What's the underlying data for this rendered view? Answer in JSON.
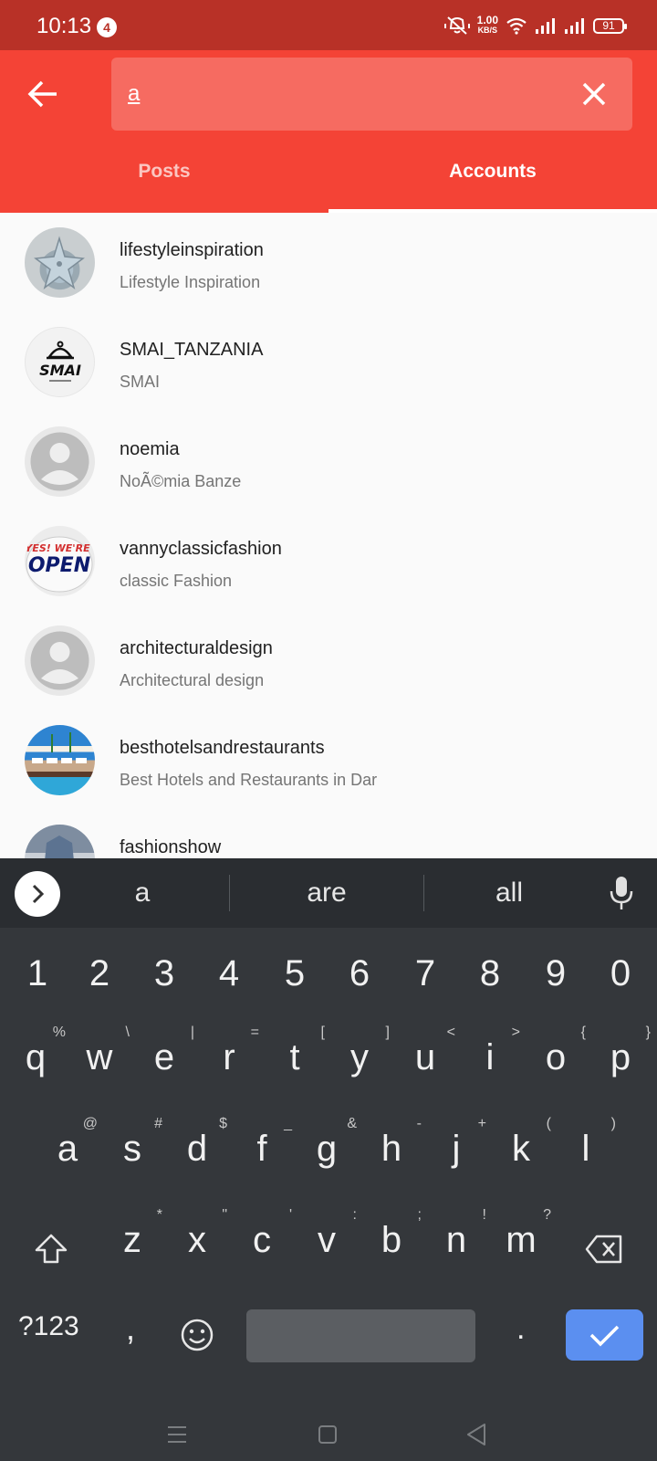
{
  "status_bar": {
    "time": "10:13",
    "notification_count": "4",
    "net_speed_value": "1.00",
    "net_speed_unit": "KB/S",
    "battery": "91"
  },
  "search": {
    "query": "a",
    "placeholder": ""
  },
  "tabs": [
    {
      "label": "Posts",
      "active": false
    },
    {
      "label": "Accounts",
      "active": true
    }
  ],
  "accounts": [
    {
      "username": "lifestyleinspiration",
      "full_name": "Lifestyle Inspiration",
      "avatar": "starfish-photo"
    },
    {
      "username": "SMAI_TANZANIA",
      "full_name": "SMAI",
      "avatar": "smai-logo"
    },
    {
      "username": "noemia",
      "full_name": "NoÃ©mia Banze",
      "avatar": "default-avatar"
    },
    {
      "username": "vannyclassicfashion",
      "full_name": "classic Fashion",
      "avatar": "open-sign"
    },
    {
      "username": "architecturaldesign",
      "full_name": "Architectural design",
      "avatar": "default-avatar"
    },
    {
      "username": "besthotelsandrestaurants",
      "full_name": "Best Hotels and Restaurants in Dar",
      "avatar": "hotel-photo"
    },
    {
      "username": "fashionshow",
      "full_name": "",
      "avatar": "fashion-photo"
    }
  ],
  "avatar_text": {
    "smai": "SMAI",
    "open_line1": "YES! WE'RE",
    "open_line2": "OPEN"
  },
  "keyboard": {
    "suggestions": [
      "a",
      "are",
      "all"
    ],
    "numbers": [
      "1",
      "2",
      "3",
      "4",
      "5",
      "6",
      "7",
      "8",
      "9",
      "0"
    ],
    "row1": [
      {
        "key": "q",
        "sub": "%"
      },
      {
        "key": "w",
        "sub": "\\"
      },
      {
        "key": "e",
        "sub": "|"
      },
      {
        "key": "r",
        "sub": "="
      },
      {
        "key": "t",
        "sub": "["
      },
      {
        "key": "y",
        "sub": "]"
      },
      {
        "key": "u",
        "sub": "<"
      },
      {
        "key": "i",
        "sub": ">"
      },
      {
        "key": "o",
        "sub": "{"
      },
      {
        "key": "p",
        "sub": "}"
      }
    ],
    "row2": [
      {
        "key": "a",
        "sub": "@"
      },
      {
        "key": "s",
        "sub": "#"
      },
      {
        "key": "d",
        "sub": "$"
      },
      {
        "key": "f",
        "sub": "_"
      },
      {
        "key": "g",
        "sub": "&"
      },
      {
        "key": "h",
        "sub": "-"
      },
      {
        "key": "j",
        "sub": "+"
      },
      {
        "key": "k",
        "sub": "("
      },
      {
        "key": "l",
        "sub": ")"
      }
    ],
    "row3": [
      {
        "key": "z",
        "sub": "*"
      },
      {
        "key": "x",
        "sub": "\""
      },
      {
        "key": "c",
        "sub": "'"
      },
      {
        "key": "v",
        "sub": ":"
      },
      {
        "key": "b",
        "sub": ";"
      },
      {
        "key": "n",
        "sub": "!"
      },
      {
        "key": "m",
        "sub": "?"
      }
    ],
    "symbols_label": "?123",
    "comma": ",",
    "period": "."
  },
  "colors": {
    "status_bar": "#b83127",
    "app_bar": "#f44336",
    "search_box": "#f66b61",
    "keyboard_bg": "#34373b",
    "enter_key": "#5b8ff0"
  }
}
